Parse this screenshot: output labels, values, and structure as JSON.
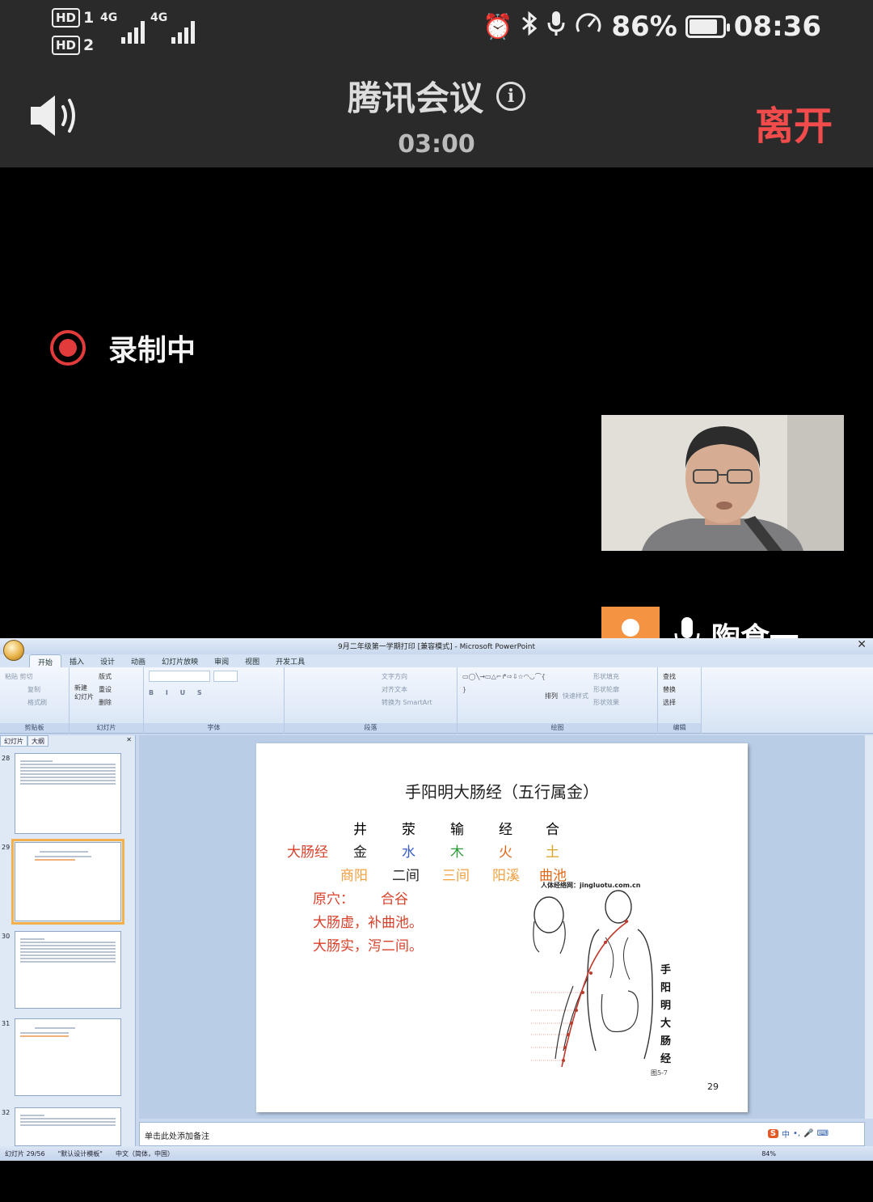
{
  "status_bar": {
    "sim1": "HD",
    "sim1_num": "1",
    "sim2": "HD",
    "sim2_num": "2",
    "net1": "4G",
    "net2": "4G",
    "battery_text": "86%",
    "battery_level": 0.86,
    "time": "08:36",
    "icons": [
      "alarm-icon",
      "bluetooth-icon",
      "mic-icon",
      "speed-icon",
      "battery-icon"
    ]
  },
  "header": {
    "title": "腾讯会议",
    "timer": "03:00",
    "leave_label": "离开",
    "leave_color": "#f24b4b"
  },
  "recording": {
    "label": "录制中",
    "color": "#e23b3b"
  },
  "participant": {
    "name": "陶食一",
    "avatar_color": "#f49342"
  },
  "ppt": {
    "window_title": "9月二年级第一学期打印 [兼容模式] - Microsoft PowerPoint",
    "tabs": [
      "开始",
      "插入",
      "设计",
      "动画",
      "幻灯片放映",
      "审阅",
      "视图",
      "开发工具"
    ],
    "ribbon": {
      "clipboard": {
        "label": "剪贴板",
        "paste": "粘贴",
        "cut": "剪切",
        "copy": "复制",
        "format_painter": "格式刷"
      },
      "slides": {
        "label": "幻灯片",
        "new_slide": "新建\n幻灯片",
        "layout": "版式",
        "reset": "重设",
        "delete": "删除"
      },
      "font": {
        "label": "字体"
      },
      "paragraph": {
        "label": "段落",
        "text_direction": "文字方向",
        "align_text": "对齐文本",
        "smartart": "转换为 SmartArt"
      },
      "drawing": {
        "label": "绘图",
        "arrange": "排列",
        "quick_styles": "快速样式",
        "fill": "形状填充",
        "outline": "形状轮廓",
        "effects": "形状效果"
      },
      "editing": {
        "label": "编辑",
        "find": "查找",
        "replace": "替换",
        "select": "选择"
      }
    },
    "panel_tabs": [
      "幻灯片",
      "大纲"
    ],
    "thumb_numbers": [
      "28",
      "29",
      "30",
      "31",
      "32"
    ],
    "slide": {
      "title": "手阳明大肠经（五行属金）",
      "headers": [
        "井",
        "荥",
        "输",
        "经",
        "合"
      ],
      "meridian": "大肠经",
      "elements": [
        {
          "text": "金",
          "color": "#222222"
        },
        {
          "text": "水",
          "color": "#3a5fcd"
        },
        {
          "text": "木",
          "color": "#2e9b3a"
        },
        {
          "text": "火",
          "color": "#e06a1a"
        },
        {
          "text": "土",
          "color": "#d7a21e"
        }
      ],
      "points": [
        {
          "text": "商阳",
          "color": "#f0a040"
        },
        {
          "text": "二间",
          "color": "#222222"
        },
        {
          "text": "三间",
          "color": "#f0a040"
        },
        {
          "text": "阳溪",
          "color": "#f0a040"
        },
        {
          "text": "曲池",
          "color": "#e06a1a"
        }
      ],
      "yuan_label": "原穴：",
      "yuan_value": "合谷",
      "line_deficiency": "大肠虚，补曲池。",
      "line_excess": "大肠实，泻二间。",
      "figure_source": "人体经络网：jingluotu.com.cn",
      "figure_caption": "手阳明大肠经",
      "figure_code": "图5-7",
      "page_number": "29",
      "accent_red": "#d9402a"
    },
    "notes_placeholder": "单击此处添加备注",
    "ime": {
      "s": "S",
      "lang": "中"
    },
    "status": {
      "slide_count": "幻灯片 29/56",
      "theme": "\"默认设计模板\"",
      "language": "中文（简体，中国）",
      "zoom": "84%"
    }
  }
}
